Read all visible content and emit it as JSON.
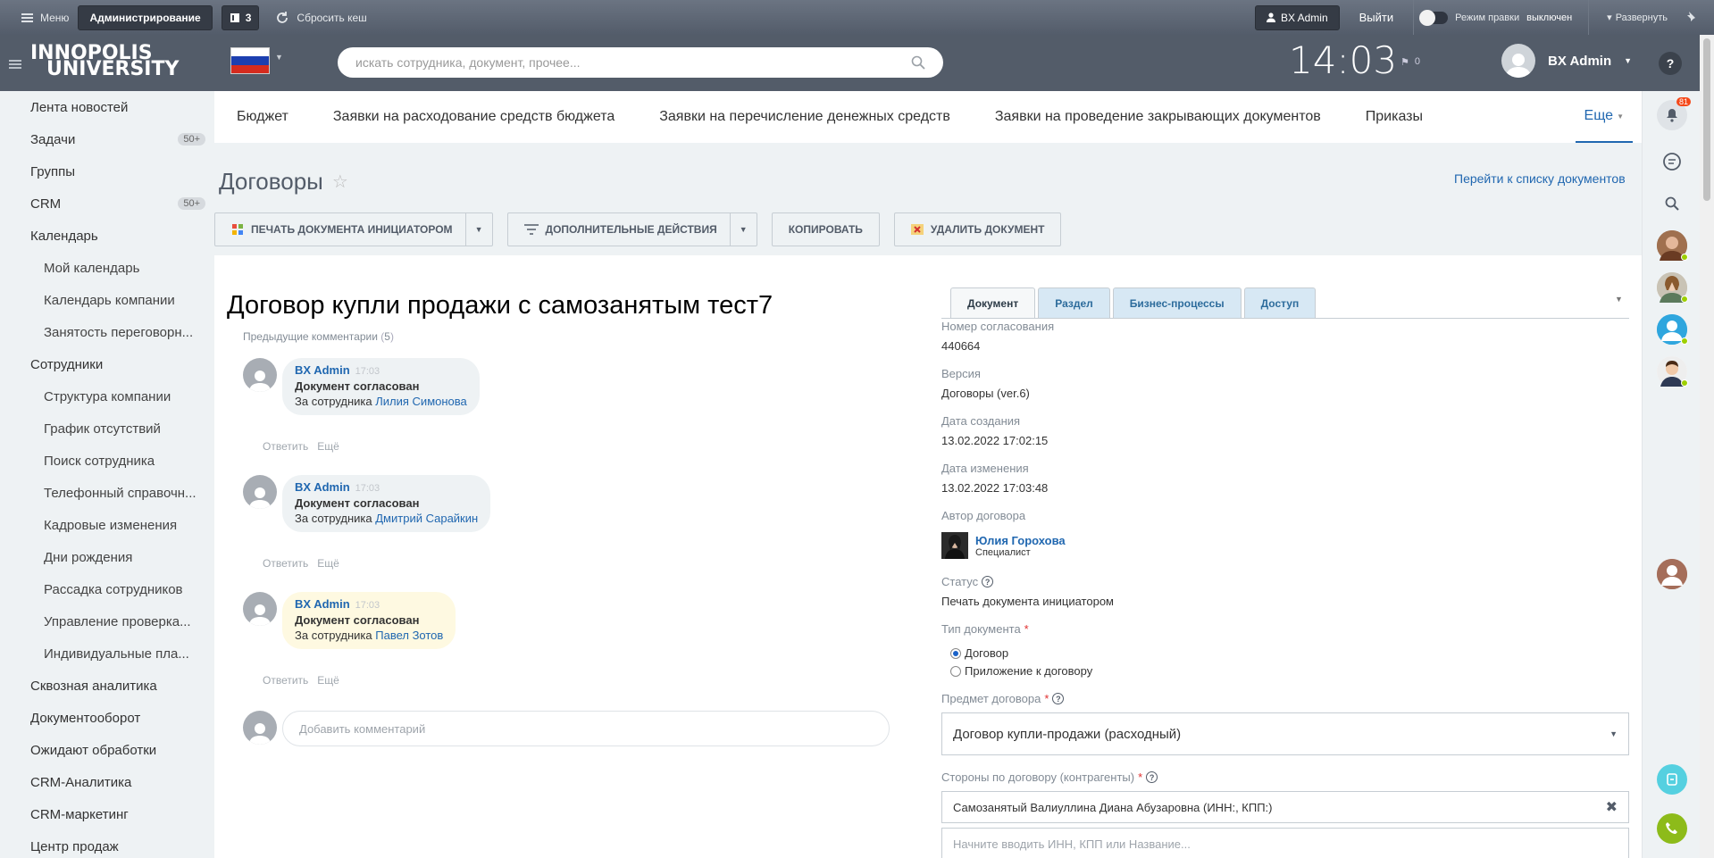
{
  "adminbar": {
    "menu_label": "Меню",
    "admin_label": "Администрирование",
    "notes_count": "3",
    "cache_label": "Сбросить кеш",
    "user_label": "BX Admin",
    "logout_label": "Выйти",
    "edit_mode_label": "Режим правки",
    "edit_mode_state": "выключен",
    "expand_label": "Развернуть"
  },
  "header": {
    "logo_line1": "INNOPOLIS",
    "logo_line2": "UNIVERSITY",
    "search_placeholder": "искать сотрудника, документ, прочее...",
    "clock": "14:03",
    "flag_count": "0",
    "user_name": "BX Admin",
    "help_label": "?"
  },
  "sidebar": {
    "items": [
      {
        "label": "Лента новостей",
        "sub": false,
        "badge": ""
      },
      {
        "label": "Задачи",
        "sub": false,
        "badge": "50+"
      },
      {
        "label": "Группы",
        "sub": false,
        "badge": ""
      },
      {
        "label": "CRM",
        "sub": false,
        "badge": "50+"
      },
      {
        "label": "Календарь",
        "sub": false,
        "badge": ""
      },
      {
        "label": "Мой календарь",
        "sub": true,
        "badge": ""
      },
      {
        "label": "Календарь компании",
        "sub": true,
        "badge": ""
      },
      {
        "label": "Занятость переговорн...",
        "sub": true,
        "badge": ""
      },
      {
        "label": "Сотрудники",
        "sub": false,
        "badge": ""
      },
      {
        "label": "Структура компании",
        "sub": true,
        "badge": ""
      },
      {
        "label": "График отсутствий",
        "sub": true,
        "badge": ""
      },
      {
        "label": "Поиск сотрудника",
        "sub": true,
        "badge": ""
      },
      {
        "label": "Телефонный справочн...",
        "sub": true,
        "badge": ""
      },
      {
        "label": "Кадровые изменения",
        "sub": true,
        "badge": ""
      },
      {
        "label": "Дни рождения",
        "sub": true,
        "badge": ""
      },
      {
        "label": "Рассадка сотрудников",
        "sub": true,
        "badge": ""
      },
      {
        "label": "Управление проверка...",
        "sub": true,
        "badge": ""
      },
      {
        "label": "Индивидуальные пла...",
        "sub": true,
        "badge": ""
      },
      {
        "label": "Сквозная аналитика",
        "sub": false,
        "badge": ""
      },
      {
        "label": "Документооборот",
        "sub": false,
        "badge": ""
      },
      {
        "label": "Ожидают обработки",
        "sub": false,
        "badge": ""
      },
      {
        "label": "CRM-Аналитика",
        "sub": false,
        "badge": ""
      },
      {
        "label": "CRM-маркетинг",
        "sub": false,
        "badge": ""
      },
      {
        "label": "Центр продаж",
        "sub": false,
        "badge": ""
      }
    ]
  },
  "tabs": {
    "items": [
      "Бюджет",
      "Заявки на расходование средств бюджета",
      "Заявки на перечисление денежных средств",
      "Заявки на проведение закрывающих документов",
      "Приказы"
    ],
    "more": "Еще"
  },
  "page": {
    "title": "Договоры",
    "goto_list": "Перейти к списку документов"
  },
  "toolbar": {
    "print": "ПЕЧАТЬ ДОКУМЕНТА ИНИЦИАТОРОМ",
    "actions": "ДОПОЛНИТЕЛЬНЫЕ ДЕЙСТВИЯ",
    "copy": "КОПИРОВАТЬ",
    "delete": "УДАЛИТЬ ДОКУМЕНТ"
  },
  "document": {
    "title": "Договор купли продажи с самозанятым тест7",
    "prev_comments_label": "Предыдущие комментарии",
    "prev_comments_count": "5",
    "comments": [
      {
        "author": "BX Admin",
        "time": "17:03",
        "text": "Документ согласован",
        "for_label": "За сотрудника",
        "for_name": "Лилия Симонова"
      },
      {
        "author": "BX Admin",
        "time": "17:03",
        "text": "Документ согласован",
        "for_label": "За сотрудника",
        "for_name": "Дмитрий Сарайкин"
      },
      {
        "author": "BX Admin",
        "time": "17:03",
        "text": "Документ согласован",
        "for_label": "За сотрудника",
        "for_name": "Павел Зотов"
      }
    ],
    "reply_label": "Ответить",
    "more_label": "Ещё",
    "add_comment_placeholder": "Добавить комментарий"
  },
  "form": {
    "tabs": [
      "Документ",
      "Раздел",
      "Бизнес-процессы",
      "Доступ"
    ],
    "approval_number_label": "Номер согласования",
    "approval_number": "440664",
    "version_label": "Версия",
    "version": "Договоры (ver.6)",
    "created_label": "Дата создания",
    "created": "13.02.2022 17:02:15",
    "modified_label": "Дата изменения",
    "modified": "13.02.2022 17:03:48",
    "author_label": "Автор договора",
    "author_name": "Юлия Горохова",
    "author_position": "Специалист",
    "status_label": "Статус",
    "status": "Печать документа инициатором",
    "doc_type_label": "Тип документа",
    "doc_type_options": [
      "Договор",
      "Приложение к договору"
    ],
    "subject_label": "Предмет договора",
    "subject": "Договор купли-продажи (расходный)",
    "parties_label": "Стороны по договору (контрагенты)",
    "party": "Самозанятый Валиуллина Диана Абузаровна (ИНН:, КПП:)",
    "party_placeholder": "Начните вводить ИНН, КПП или Название..."
  },
  "right_panel": {
    "notifications_count": "81"
  },
  "colors": {
    "header_bg": "#535c69",
    "accent": "#2067b0",
    "adminbar_bg": "#5f6875"
  }
}
